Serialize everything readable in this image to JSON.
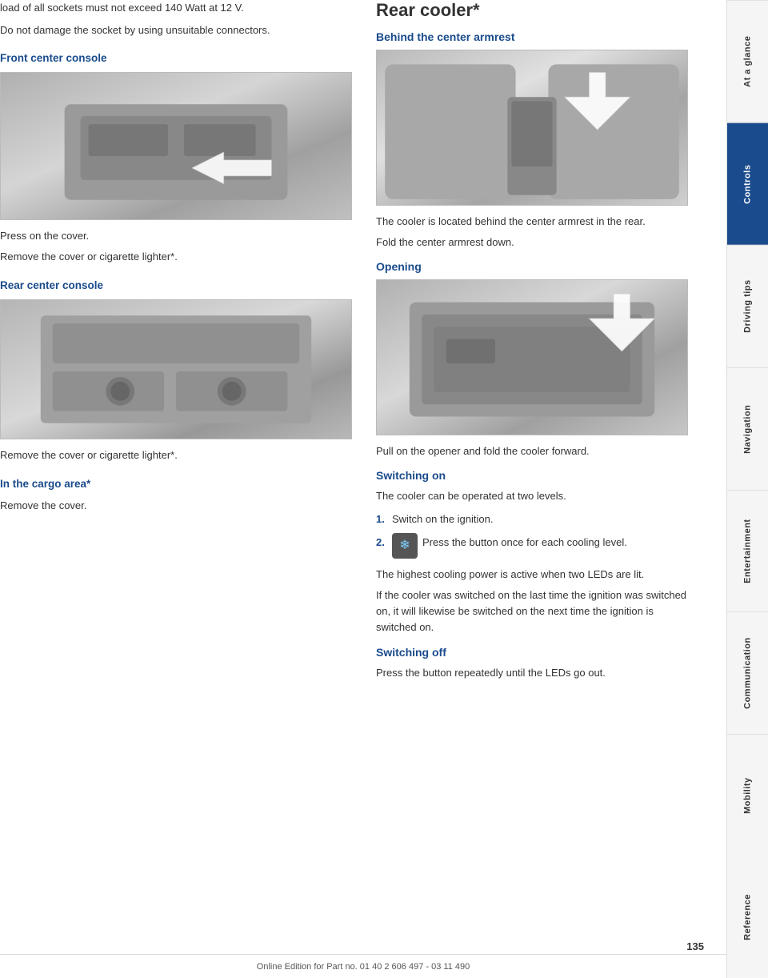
{
  "left_column": {
    "intro_lines": [
      "load of all sockets must not exceed 140 Watt at 12 V.",
      "Do not damage the socket by using unsuitable connectors."
    ],
    "front_console": {
      "heading": "Front center console",
      "lines": [
        "Press on the cover.",
        "Remove the cover or cigarette lighter*."
      ]
    },
    "rear_console": {
      "heading": "Rear center console",
      "lines": [
        "Remove the cover or cigarette lighter*."
      ]
    },
    "cargo_area": {
      "heading": "In the cargo area*",
      "lines": [
        "Remove the cover."
      ]
    }
  },
  "right_column": {
    "page_title": "Rear cooler*",
    "behind_armrest": {
      "heading": "Behind the center armrest",
      "lines": [
        "The cooler is located behind the center armrest in the rear.",
        "Fold the center armrest down."
      ]
    },
    "opening": {
      "heading": "Opening",
      "lines": [
        "Pull on the opener and fold the cooler forward."
      ]
    },
    "switching_on": {
      "heading": "Switching on",
      "intro": "The cooler can be operated at two levels.",
      "steps": [
        {
          "num": "1.",
          "text": "Switch on the ignition."
        },
        {
          "num": "2.",
          "text": "Press the button once for each cooling level."
        }
      ],
      "note1": "The highest cooling power is active when two LEDs are lit.",
      "note2": "If the cooler was switched on the last time the ignition was switched on, it will likewise be switched on the next time the ignition is switched on."
    },
    "switching_off": {
      "heading": "Switching off",
      "text": "Press the button repeatedly until the LEDs go out."
    }
  },
  "sidebar": {
    "items": [
      {
        "label": "At a glance",
        "active": false
      },
      {
        "label": "Controls",
        "active": true
      },
      {
        "label": "Driving tips",
        "active": false
      },
      {
        "label": "Navigation",
        "active": false
      },
      {
        "label": "Entertainment",
        "active": false
      },
      {
        "label": "Communication",
        "active": false
      },
      {
        "label": "Mobility",
        "active": false
      },
      {
        "label": "Reference",
        "active": false
      }
    ]
  },
  "footer": {
    "text": "Online Edition for Part no. 01 40 2 606 497 - 03 11 490"
  },
  "page_number": "135"
}
